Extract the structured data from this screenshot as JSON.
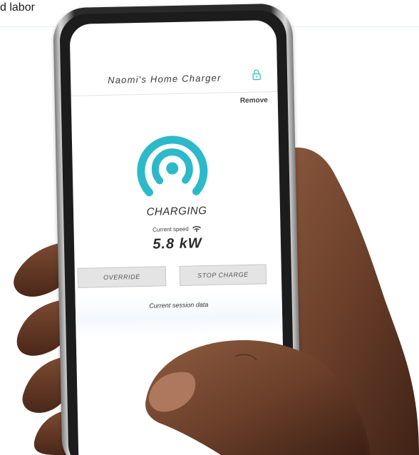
{
  "page": {
    "top_text": "d labor"
  },
  "charger": {
    "title": "Naomi's Home Charger",
    "lock_icon": "padlock-icon",
    "remove_label": "Remove",
    "signal_icon": "charging-signal-icon",
    "status": "CHARGING",
    "speed_label": "Current speed",
    "speed_icon": "wifi-signal-icon",
    "speed_value": "5.8 kW",
    "override_label": "OVERRIDE",
    "stop_label": "STOP CHARGE",
    "session_label": "Current session data"
  },
  "colors": {
    "accent": "#2cb9c9",
    "skin": "#6b3f2a",
    "skin_highlight": "#8b5a3e",
    "skin_shadow": "#3f2216"
  }
}
